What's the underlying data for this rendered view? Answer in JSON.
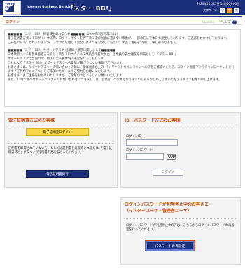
{
  "header": {
    "logo_text": "TOKYO STAR BANK",
    "service_name": "Internet Business Banking",
    "brand": "「スター BB!」",
    "datetime": "2020年10月13日 14時00分00秒",
    "size_label": "文字サイズ",
    "sizes": [
      "小",
      "中",
      "大"
    ],
    "selected_size": "中"
  },
  "titlebar": {
    "title": "ログイン",
    "code": "BLGI001",
    "help_label": "ヘルプ",
    "help_icon": "question-mark-icon"
  },
  "notice": {
    "lines": [
      "■■■■■「スター BB!」障害発生のお知らせ■■■■■（2020年3月7日13:50）",
      "電子証明書方式にてログインする際、ログインボタンを押下後に次の画面に進まない事象が、一部の方法で本日も発生しております。ご迷惑をおかけしております。",
      "ご対処の方法：恐れ入りますが、ブラウザを閉じて再度ログインをお試しください。大変ご迷惑をお掛けし申し訳ありません。"
    ],
    "lines2": [
      "■■■■■「スター BB!」サポートデスク 越境縮小運営に関しまして■■■■■",
      "日本政府による緊急事態宣言を受け、新型コロナウイルス感染症の拡大防止、従業員の安全確保を目的として、「スター BB!」",
      "サポートデスクは当面の間、縮小した人員体制で運営を行っております。",
      "これにより「スター BB!」サポートデスクへの電話が繋がりにくい事象がございます。",
      "お客さまには、サポートデスクへの問い合わせの前に、操作画面右上の「?」マークからオンラインヘルプをご確認いただき、ログイン画面下からダウンロードいただけます「ご利用マニュアル」をご確認いただくようご協力をお願いいたします。",
      "お客さまにはご迷惑をおかけいたしますが、ご理解のほどよろしくお願いいたします。",
      "また、11時以降のサポートデスクへのお問い合わせにつきましては、営業窓口の営業となりますのであらかじめご了承いただきますようお願い申し上げます。"
    ]
  },
  "cert_panel": {
    "heading": "電子証明書方式のお客様",
    "login_button": "電子証明書ログイン",
    "help_text": "証明書を取得されていない方、もしくは証明書を再取得される方は、「電子証明書発行」ボタンより証明書の発行を行ってください。",
    "issue_button": "電子証明書発行"
  },
  "id_panel": {
    "heading": "ID・パスワード方式のお客様",
    "login_id_label": "ログインID",
    "login_id_value": "",
    "password_label": "ログインパスワード",
    "password_value": "",
    "keyboard_icon": "software-keyboard-icon",
    "login_button": "ログイン"
  },
  "locked_panel": {
    "heading_line1": "ログインパスワードが利用停止中のお客さま",
    "heading_line2": "（マスターユーザ・管理者ユーザ）",
    "body": "ログインパスワードが利用停止中の方は、こちらからログインパスワードの再設定を行ってください。",
    "reset_button": "パスワードの再設定"
  }
}
